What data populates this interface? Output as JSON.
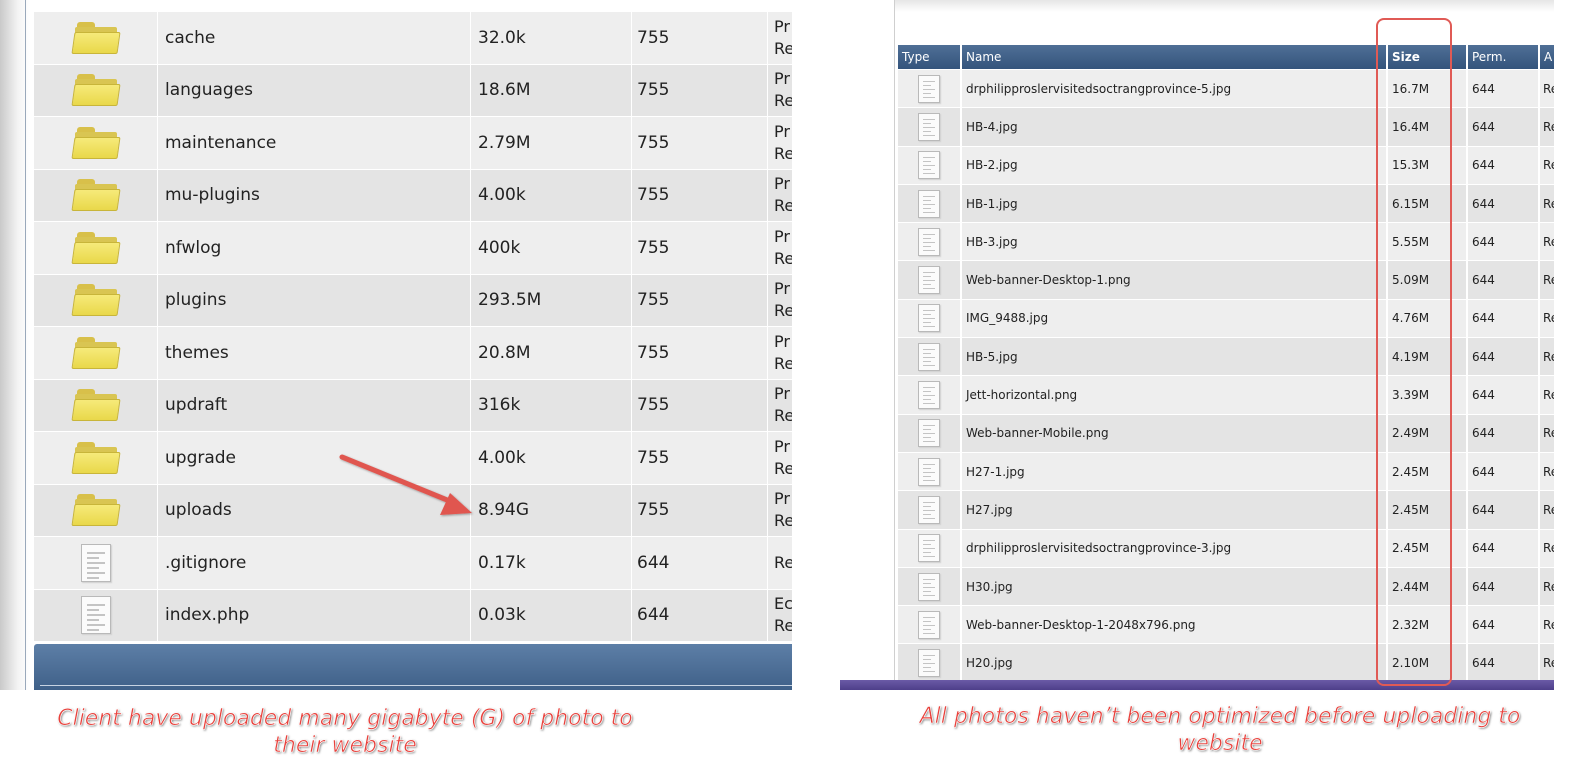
{
  "left_listing": {
    "rows": [
      {
        "type": "folder",
        "name": "cache",
        "size": "32.0k",
        "perm": "755",
        "action_1": "Pr",
        "action_2": "Re"
      },
      {
        "type": "folder",
        "name": "languages",
        "size": "18.6M",
        "perm": "755",
        "action_1": "Pr",
        "action_2": "Re"
      },
      {
        "type": "folder",
        "name": "maintenance",
        "size": "2.79M",
        "perm": "755",
        "action_1": "Pr",
        "action_2": "Re"
      },
      {
        "type": "folder",
        "name": "mu-plugins",
        "size": "4.00k",
        "perm": "755",
        "action_1": "Pr",
        "action_2": "Re"
      },
      {
        "type": "folder",
        "name": "nfwlog",
        "size": "400k",
        "perm": "755",
        "action_1": "Pr",
        "action_2": "Re"
      },
      {
        "type": "folder",
        "name": "plugins",
        "size": "293.5M",
        "perm": "755",
        "action_1": "Pr",
        "action_2": "Re"
      },
      {
        "type": "folder",
        "name": "themes",
        "size": "20.8M",
        "perm": "755",
        "action_1": "Pr",
        "action_2": "Re"
      },
      {
        "type": "folder",
        "name": "updraft",
        "size": "316k",
        "perm": "755",
        "action_1": "Pr",
        "action_2": "Re"
      },
      {
        "type": "folder",
        "name": "upgrade",
        "size": "4.00k",
        "perm": "755",
        "action_1": "Pr",
        "action_2": "Re"
      },
      {
        "type": "folder",
        "name": "uploads",
        "size": "8.94G",
        "perm": "755",
        "action_1": "Pr",
        "action_2": "Re"
      },
      {
        "type": "file",
        "name": ".gitignore",
        "size": "0.17k",
        "perm": "644",
        "action_1": "Re",
        "action_2": ""
      },
      {
        "type": "file",
        "name": "index.php",
        "size": "0.03k",
        "perm": "644",
        "action_1": "Ec",
        "action_2": "Re"
      }
    ]
  },
  "right_listing": {
    "headers": {
      "type": "Type",
      "name": "Name",
      "size": "Size",
      "perm": "Perm.",
      "act": "A"
    },
    "rows": [
      {
        "name": "drphilipproslervisitedsoctrangprovince-5.jpg",
        "size": "16.7M",
        "perm": "644",
        "act": "Re"
      },
      {
        "name": "HB-4.jpg",
        "size": "16.4M",
        "perm": "644",
        "act": "Re"
      },
      {
        "name": "HB-2.jpg",
        "size": "15.3M",
        "perm": "644",
        "act": "Re"
      },
      {
        "name": "HB-1.jpg",
        "size": "6.15M",
        "perm": "644",
        "act": "Re"
      },
      {
        "name": "HB-3.jpg",
        "size": "5.55M",
        "perm": "644",
        "act": "Re"
      },
      {
        "name": "Web-banner-Desktop-1.png",
        "size": "5.09M",
        "perm": "644",
        "act": "Re"
      },
      {
        "name": "IMG_9488.jpg",
        "size": "4.76M",
        "perm": "644",
        "act": "Re"
      },
      {
        "name": "HB-5.jpg",
        "size": "4.19M",
        "perm": "644",
        "act": "Re"
      },
      {
        "name": "Jett-horizontal.png",
        "size": "3.39M",
        "perm": "644",
        "act": "Re"
      },
      {
        "name": "Web-banner-Mobile.png",
        "size": "2.49M",
        "perm": "644",
        "act": "Re"
      },
      {
        "name": "H27-1.jpg",
        "size": "2.45M",
        "perm": "644",
        "act": "Re"
      },
      {
        "name": "H27.jpg",
        "size": "2.45M",
        "perm": "644",
        "act": "Re"
      },
      {
        "name": "drphilipproslervisitedsoctrangprovince-3.jpg",
        "size": "2.45M",
        "perm": "644",
        "act": "Re"
      },
      {
        "name": "H30.jpg",
        "size": "2.44M",
        "perm": "644",
        "act": "Re"
      },
      {
        "name": "Web-banner-Desktop-1-2048x796.png",
        "size": "2.32M",
        "perm": "644",
        "act": "Re"
      },
      {
        "name": "H20.jpg",
        "size": "2.10M",
        "perm": "644",
        "act": "Re"
      }
    ]
  },
  "annotations": {
    "caption_left": "Client have uploaded many gigabyte (G) of photo to their website",
    "caption_right": "All photos haven’t been optimized before uploading to website",
    "accent_color": "#e8413c",
    "header_color": "#4a6a90"
  }
}
